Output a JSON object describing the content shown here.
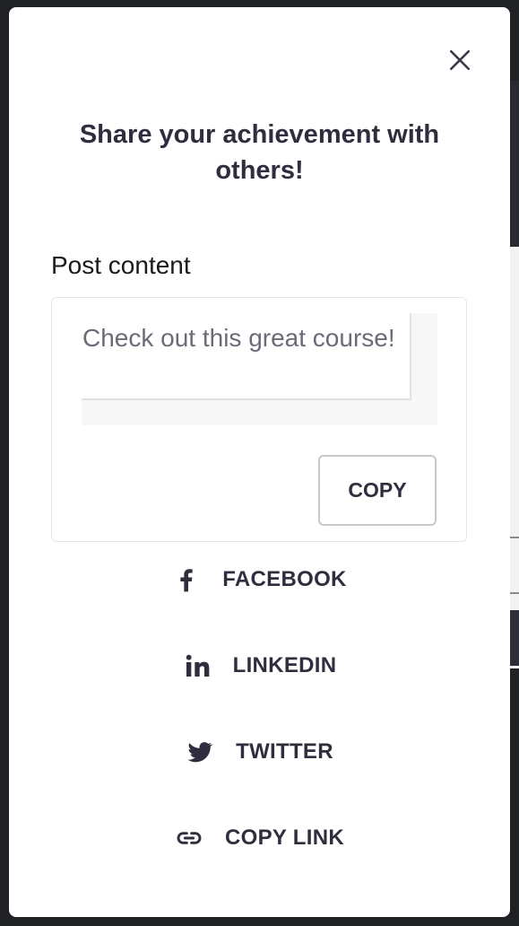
{
  "modal": {
    "title": "Share your achievement with others!",
    "post_content_label": "Post content",
    "post_content_text": "Check out this great course!",
    "copy_label": "COPY"
  },
  "share_options": [
    {
      "label": "FACEBOOK",
      "icon": "facebook-icon"
    },
    {
      "label": "LINKEDIN",
      "icon": "linkedin-icon"
    },
    {
      "label": "TWITTER",
      "icon": "twitter-icon"
    },
    {
      "label": "COPY LINK",
      "icon": "link-icon"
    }
  ],
  "colors": {
    "text_dark": "#2e2e3f",
    "placeholder": "#6b6b78",
    "overlay": "#202124"
  }
}
